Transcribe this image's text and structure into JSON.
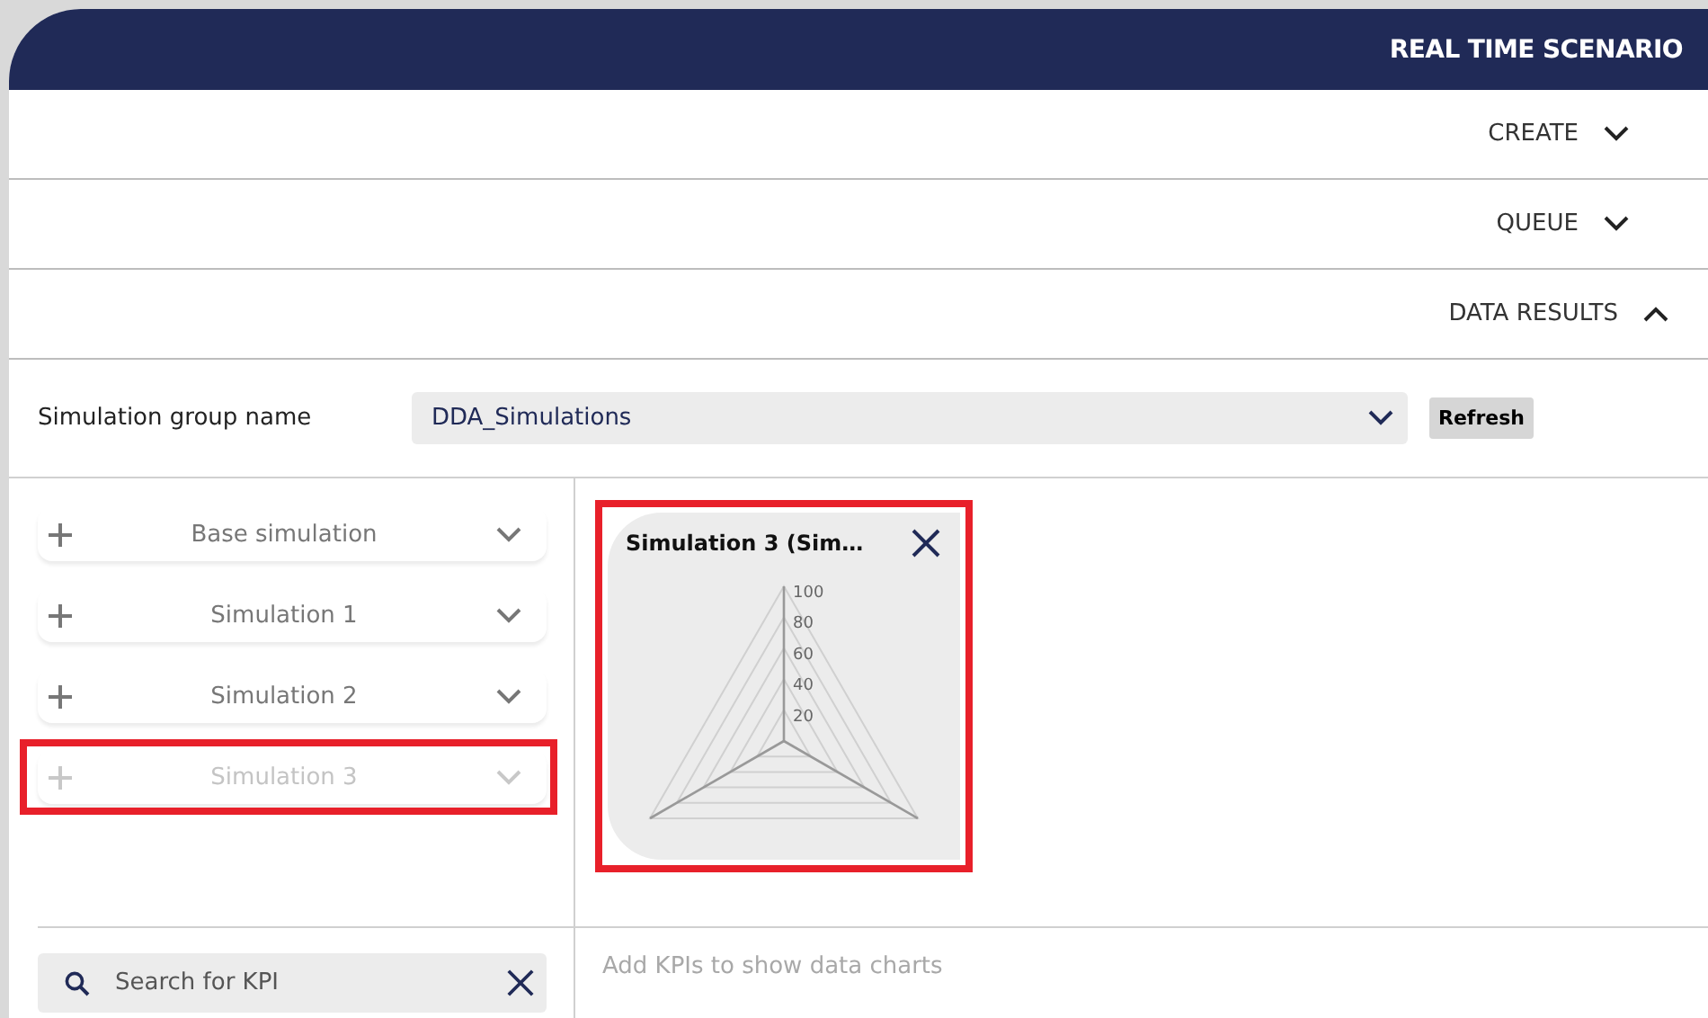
{
  "header": {
    "title": "REAL TIME SCENARIO"
  },
  "sections": [
    {
      "label": "CREATE",
      "expanded": false
    },
    {
      "label": "QUEUE",
      "expanded": false
    },
    {
      "label": "DATA RESULTS",
      "expanded": true
    }
  ],
  "group": {
    "label": "Simulation group name",
    "value": "DDA_Simulations",
    "refresh": "Refresh"
  },
  "simulations": [
    {
      "name": "Base simulation",
      "disabled": false,
      "highlighted": false
    },
    {
      "name": "Simulation 1",
      "disabled": false,
      "highlighted": false
    },
    {
      "name": "Simulation 2",
      "disabled": false,
      "highlighted": false
    },
    {
      "name": "Simulation 3",
      "disabled": true,
      "highlighted": true
    }
  ],
  "charts": [
    {
      "title": "Simulation 3 (Sim…",
      "highlighted": true,
      "ticks": [
        "100",
        "80",
        "60",
        "40",
        "20"
      ]
    }
  ],
  "kpi_search": {
    "placeholder": "Search for KPI"
  },
  "empty_message": "Add KPIs to show data charts"
}
